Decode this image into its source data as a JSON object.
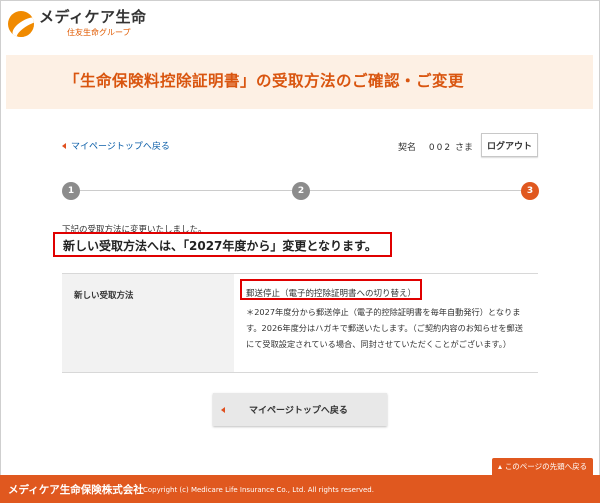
{
  "header": {
    "brand_name": "メディケア生命",
    "brand_sub": "住友生命グループ",
    "page_title": "「生命保険料控除証明書」の受取方法のご確認・ご変更"
  },
  "nav": {
    "back_link": "マイページトップへ戻る",
    "contract_label": "契名",
    "contract_number": "002",
    "contract_suffix": "さま",
    "logout_label": "ログアウト"
  },
  "steps": {
    "items": [
      "1",
      "2",
      "3"
    ],
    "current": "3"
  },
  "message": {
    "small": "下記の受取方法に変更いたしました。",
    "big": "新しい受取方法へは、「2027年度から」変更となります。"
  },
  "table": {
    "row_label": "新しい受取方法",
    "value_title": "郵送停止（電子的控除証明書への切り替え）",
    "value_desc": "＊2027年度分から郵送停止（電子的控除証明書を毎年自動発行）となります。2026年度分はハガキで郵送いたします。（ご契約内容のお知らせを郵送にて受取設定されている場合、同封させていただくことがございます。）"
  },
  "buttons": {
    "back_to_top": "マイページトップへ戻る",
    "page_top": "このページの先頭へ戻る"
  },
  "footer": {
    "company": "メディケア生命保険株式会社",
    "copyright": "Copyright (c) Medicare Life Insurance Co., Ltd. All rights reserved."
  },
  "colors": {
    "accent": "#e0581f",
    "title": "#d9550f",
    "highlight_box": "#e00000",
    "link": "#0b5ea8",
    "title_band": "#fdf0e4"
  }
}
